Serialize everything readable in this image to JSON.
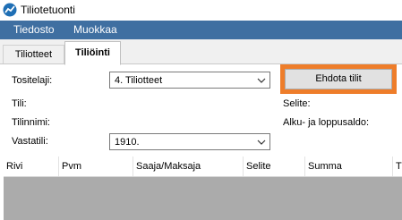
{
  "window": {
    "title": "Tiliotetuonti"
  },
  "menu": {
    "items": [
      "Tiedosto",
      "Muokkaa"
    ]
  },
  "tabs": [
    {
      "label": "Tiliotteet",
      "active": false
    },
    {
      "label": "Tiliöinti",
      "active": true
    }
  ],
  "form": {
    "tositelaji_label": "Tositelaji:",
    "tositelaji_value": "4. Tiliotteet",
    "tili_label": "Tili:",
    "tilinnimi_label": "Tilinnimi:",
    "vastatili_label": "Vastatili:",
    "vastatili_value": "1910.",
    "selite_label": "Selite:",
    "saldo_label": "Alku- ja loppusaldo:",
    "suggest_button": "Ehdota tilit"
  },
  "grid": {
    "columns": [
      "Rivi",
      "Pvm",
      "Saaja/Maksaja",
      "Selite",
      "Summa",
      "T"
    ]
  },
  "colors": {
    "menubar": "#3f6fa1",
    "highlight": "#ee7d2a",
    "grid_background": "#ababab"
  },
  "icons": {
    "app": "app-logo-icon",
    "dropdown": "chevron-down-icon"
  }
}
